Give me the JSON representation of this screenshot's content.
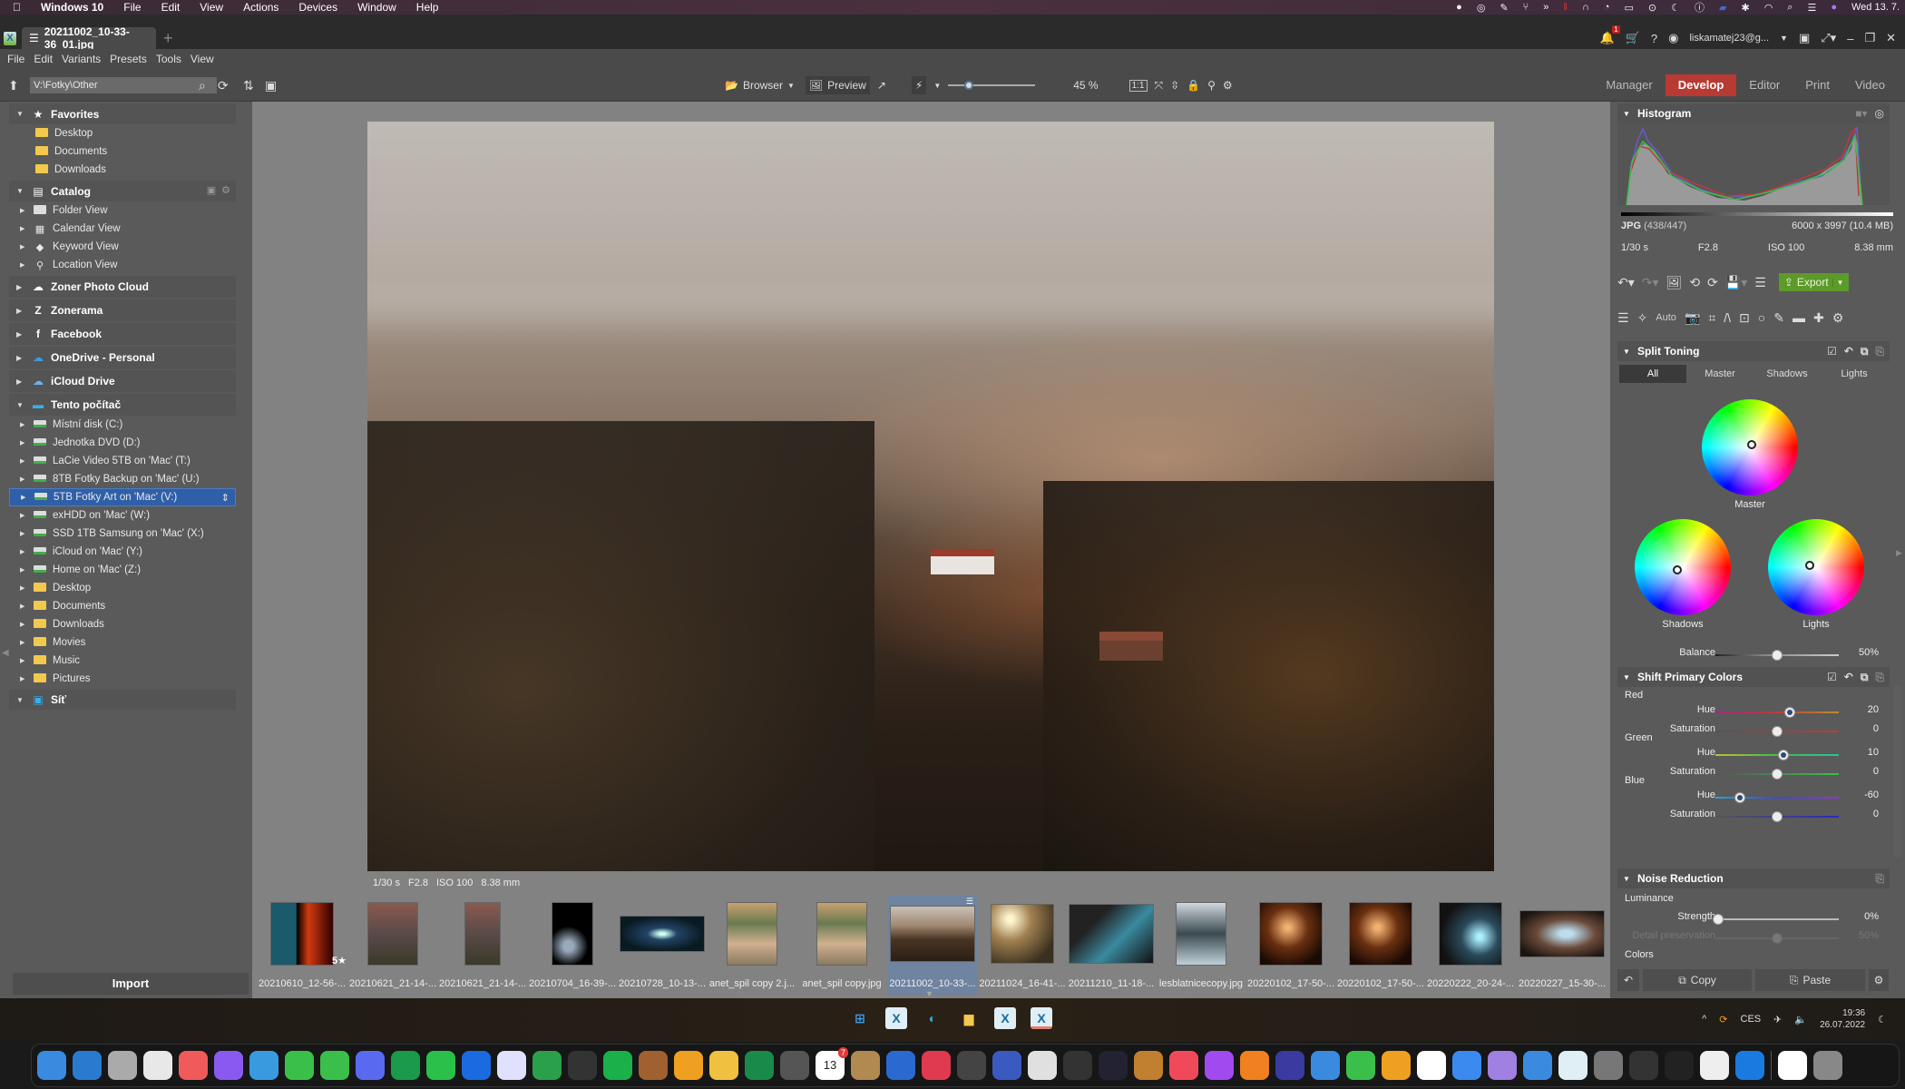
{
  "mac_menubar": {
    "app_name": "Windows 10",
    "menus": [
      "File",
      "Edit",
      "View",
      "Actions",
      "Devices",
      "Window",
      "Help"
    ],
    "clock": "Wed 13. 7."
  },
  "titlebar": {
    "tab_title": "20211002_10-33-36_01.jpg",
    "new_tab": "+",
    "notification_count": "1",
    "user": "liskamatej23@g...",
    "help": "?"
  },
  "app_menu": [
    "File",
    "Edit",
    "Variants",
    "Presets",
    "Tools",
    "View"
  ],
  "toolbar": {
    "path": "V:\\Fotky\\Other",
    "browser_label": "Browser",
    "preview_label": "Preview",
    "zoom_level": "45 %",
    "zoom_fraction": 0.18,
    "modes": [
      "Manager",
      "Develop",
      "Editor",
      "Print",
      "Video"
    ],
    "active_mode": "Develop"
  },
  "sidebar": {
    "favorites": {
      "label": "Favorites",
      "items": [
        "Desktop",
        "Documents",
        "Downloads"
      ]
    },
    "catalog": {
      "label": "Catalog",
      "items": [
        "Folder View",
        "Calendar View",
        "Keyword View",
        "Location View"
      ]
    },
    "services": [
      "Zoner Photo Cloud",
      "Zonerama",
      "Facebook",
      "OneDrive - Personal",
      "iCloud Drive"
    ],
    "computer": {
      "label": "Tento počítač",
      "items": [
        "Místní disk (C:)",
        "Jednotka DVD (D:)",
        "LaCie Video 5TB on 'Mac' (T:)",
        "8TB Fotky Backup on 'Mac' (U:)",
        "5TB Fotky Art on 'Mac' (V:)",
        "exHDD on 'Mac' (W:)",
        "SSD 1TB Samsung on 'Mac' (X:)",
        "iCloud on 'Mac' (Y:)",
        "Home on 'Mac' (Z:)",
        "Desktop",
        "Documents",
        "Downloads",
        "Movies",
        "Music",
        "Pictures"
      ],
      "selected": "5TB Fotky Art on 'Mac' (V:)"
    },
    "network": {
      "label": "Síť"
    },
    "import_label": "Import"
  },
  "photo_info": {
    "shutter": "1/30 s",
    "aperture": "F2.8",
    "iso": "ISO 100",
    "focal": "8.38 mm"
  },
  "filmstrip": [
    {
      "name": "20210610_12-56-...",
      "rating": "5★"
    },
    {
      "name": "20210621_21-14-..."
    },
    {
      "name": "20210621_21-14-..."
    },
    {
      "name": "20210704_16-39-..."
    },
    {
      "name": "20210728_10-13-..."
    },
    {
      "name": "anet_spil copy 2.j..."
    },
    {
      "name": "anet_spil copy.jpg"
    },
    {
      "name": "20211002_10-33-...",
      "selected": true
    },
    {
      "name": "20211024_16-41-..."
    },
    {
      "name": "20211210_11-18-..."
    },
    {
      "name": "lesblatnicecopy.jpg"
    },
    {
      "name": "20220102_17-50-..."
    },
    {
      "name": "20220102_17-50-..."
    },
    {
      "name": "20220222_20-24-..."
    },
    {
      "name": "20220227_15-30-..."
    }
  ],
  "right_panel": {
    "histogram": {
      "title": "Histogram",
      "format": "JPG",
      "index": "(438/447)",
      "dimensions": "6000 x 3997 (10.4 MB)",
      "shutter": "1/30 s",
      "aperture": "F2.8",
      "iso": "ISO 100",
      "focal": "8.38 mm"
    },
    "export_label": "Export",
    "auto_label": "Auto",
    "split_toning": {
      "title": "Split Toning",
      "tabs": [
        "All",
        "Master",
        "Shadows",
        "Lights"
      ],
      "active_tab": "All",
      "wheels": [
        "Master",
        "Shadows",
        "Lights"
      ],
      "balance_label": "Balance",
      "balance_value": "50%"
    },
    "shift_primary": {
      "title": "Shift Primary Colors",
      "groups": [
        {
          "name": "Red",
          "hue_label": "Hue",
          "hue": "20",
          "sat_label": "Saturation",
          "sat": "0"
        },
        {
          "name": "Green",
          "hue_label": "Hue",
          "hue": "10",
          "sat_label": "Saturation",
          "sat": "0"
        },
        {
          "name": "Blue",
          "hue_label": "Hue",
          "hue": "-60",
          "sat_label": "Saturation",
          "sat": "0"
        }
      ]
    },
    "noise_reduction": {
      "title": "Noise Reduction",
      "luminance_label": "Luminance",
      "strength_label": "Strength",
      "strength": "0%",
      "detail_label": "Detail preservation",
      "detail": "50%",
      "colors_label": "Colors"
    },
    "copy_label": "Copy",
    "paste_label": "Paste"
  },
  "taskbar": {
    "language": "CES",
    "time": "19:36",
    "date": "26.07.2022"
  },
  "dock_count_badge": "7",
  "dock_calendar_day": "13"
}
